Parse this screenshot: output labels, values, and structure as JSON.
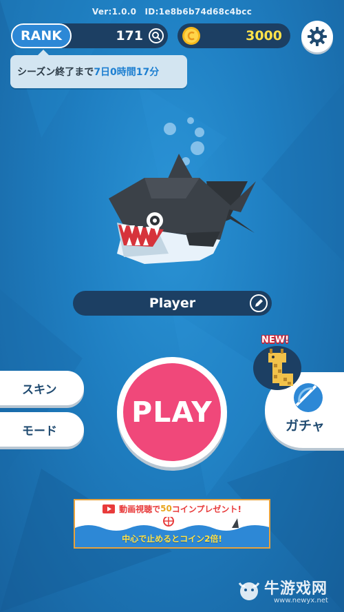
{
  "header": {
    "version_text": "Ver:1.0.0　ID:1e8b6b74d68c4bcc"
  },
  "rank": {
    "label": "RANK",
    "value": "171",
    "search_icon": "search-icon"
  },
  "coins": {
    "value": "3000",
    "icon": "coin-icon"
  },
  "settings": {
    "icon": "gear-icon"
  },
  "season": {
    "prefix": "シーズン終了まで",
    "remaining": "7日0時間17分"
  },
  "player": {
    "name": "Player",
    "edit_icon": "pencil-icon"
  },
  "menu": {
    "skin_label": "スキン",
    "mode_label": "モード",
    "play_label": "PLAY",
    "gacha_label": "ガチャ",
    "new_badge": "NEW!"
  },
  "ad_banner": {
    "top_prefix": "動画視聴で",
    "top_number": "50",
    "top_suffix": "コインプレゼント!",
    "bottom_text": "中心で止めるとコイン2倍!"
  },
  "watermark": {
    "title": "牛游戏网",
    "url": "www.newyx.net"
  },
  "colors": {
    "background": "#1f7fc2",
    "play": "#f0487a",
    "coin_text": "#ffe24a",
    "rank_pill": "#2d88d6",
    "dark_bar": "#1c3f63"
  }
}
